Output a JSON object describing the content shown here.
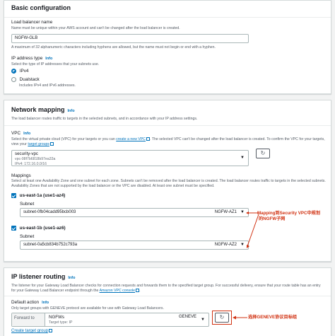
{
  "basic": {
    "title": "Basic configuration",
    "lb_name_label": "Load balancer name",
    "lb_name_desc": "Name must be unique within your AWS account and can't be changed after the load balancer is created.",
    "lb_name_value": "NGFW-GLB",
    "lb_name_hint": "A maximum of 32 alphanumeric characters including hyphens are allowed, but the name must not begin or end with a hyphen.",
    "ip_type_label": "IP address type",
    "ip_type_info": "Info",
    "ip_type_desc": "Select the type of IP addresses that your subnets use.",
    "ipv4_label": "IPv4",
    "dualstack_label": "Dualstack",
    "dualstack_desc": "Includes IPv4 and IPv6 addresses."
  },
  "network": {
    "title": "Network mapping",
    "info": "Info",
    "desc": "The load balancer routes traffic to targets in the selected subnets, and in accordance with your IP address settings.",
    "vpc_label": "VPC",
    "vpc_info": "Info",
    "vpc_desc_1": "Select the virtual private cloud (VPC) for your targets or you can",
    "vpc_desc_link": "create a new VPC",
    "vpc_desc_2": ". The selected VPC can't be changed after the load balancer is created. To confirm the VPC for your targets, view your",
    "vpc_desc_link2": "target groups",
    "vpc_name": "security-vpc",
    "vpc_id": "vpc-08f7b6818b97ea33a",
    "vpc_ipv4": "IPv4: 172.16.0.0/16",
    "mappings_label": "Mappings",
    "mappings_desc": "Select at least one Availability Zone and one subnet for each zone. Subnets can't be removed after the load balancer is created. The load balancer routes traffic to targets in the selected subnets. Availability Zones that are not supported by the load balancer or the VPC are disabled. At least one subnet must be specified.",
    "az1_label": "us-east-1a (use1-az4)",
    "az1_subnet_label": "Subnet",
    "az1_subnet": "subnet-0fb04cadd95bcb003",
    "az1_tag": "NGFW-AZ1",
    "az2_label": "us-east-1b (use1-az6)",
    "az2_subnet_label": "Subnet",
    "az2_subnet": "subnet-0a5cb834b752c793a",
    "az2_tag": "NGFW-AZ2",
    "annotation_1": "Mapping到Security VPC中规划",
    "annotation_2": "的NGFW子网"
  },
  "listener": {
    "title": "IP listener routing",
    "info": "Info",
    "desc_1": "The listener for your Gateway Load Balancer checks for connection requests and forwards them to the specified target group. For successful delivery, ensure that your route table has an entry for your Gateway Load Balancer endpoint through the",
    "desc_link": "Amazon VPC console",
    "default_action_label": "Default action",
    "default_action_info": "Info",
    "default_action_desc": "Only target groups with GENEVE protocol are available for use with Gateway Load Balancers.",
    "forward_to": "Forward to",
    "tg_name": "NGFWs",
    "tg_type": "Target type: IP",
    "tg_protocol": "GENEVE",
    "create_tg_link": "Create target group",
    "annotation": "选择GENEVE协议目标组"
  },
  "colors": {
    "accent": "#0073bb",
    "annotation": "#d13212"
  }
}
